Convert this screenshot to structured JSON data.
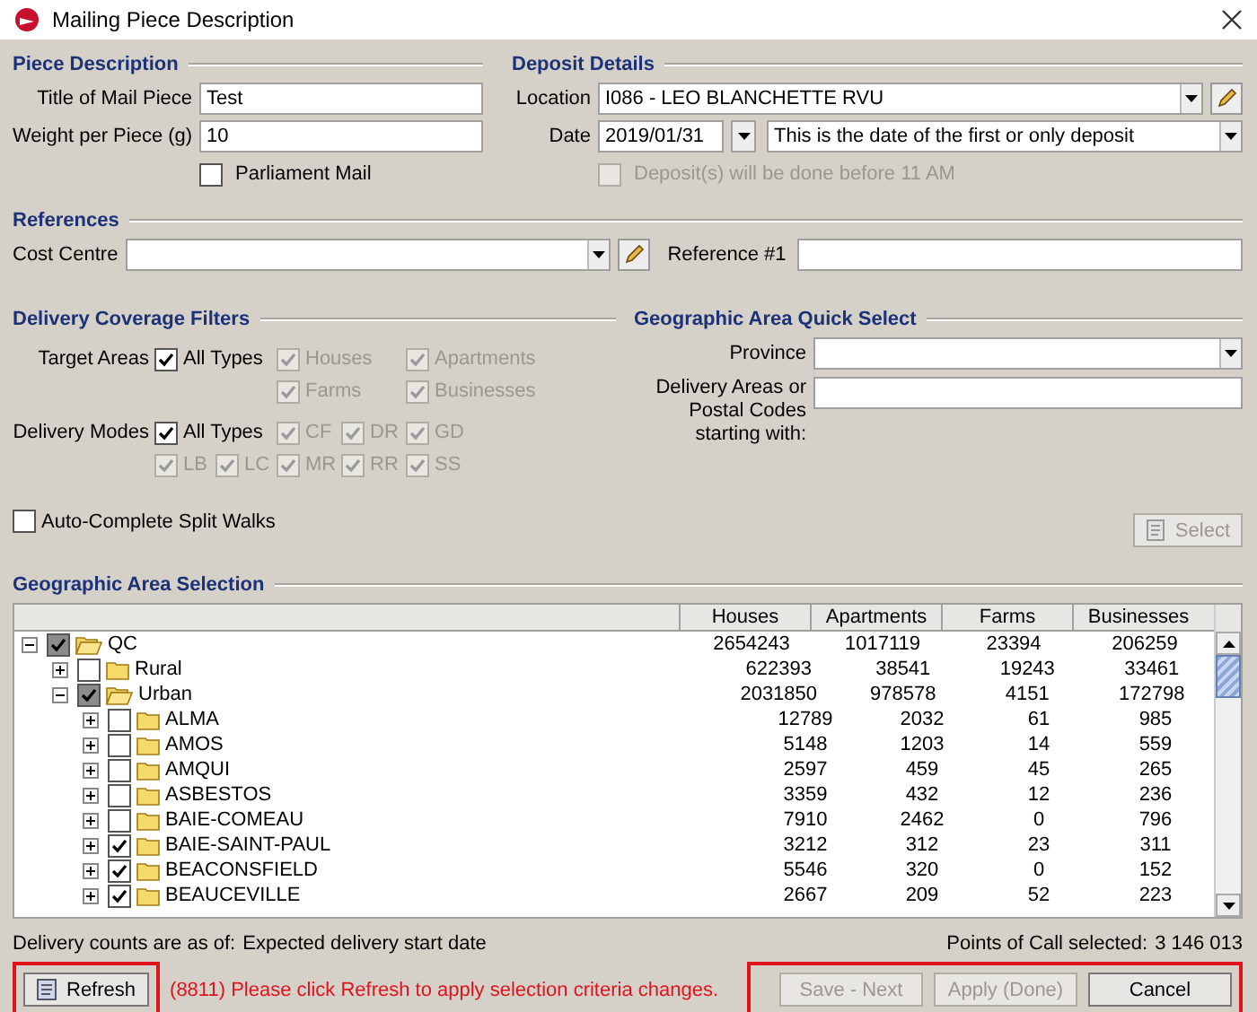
{
  "window": {
    "title": "Mailing Piece Description"
  },
  "piece_description": {
    "heading": "Piece Description",
    "fields": [
      {
        "label": "Title of Mail Piece",
        "value": "Test"
      },
      {
        "label": "Weight per Piece (g)",
        "value": "10"
      }
    ],
    "parliament_mail": {
      "label": "Parliament Mail",
      "checked": false
    }
  },
  "deposit_details": {
    "heading": "Deposit Details",
    "location": {
      "label": "Location",
      "value": "I086 - LEO BLANCHETTE RVU"
    },
    "date": {
      "label": "Date",
      "value": "2019/01/31",
      "note": "This is the date of the first or only deposit"
    },
    "before_11": {
      "label": "Deposit(s) will be done before 11 AM",
      "checked": false,
      "disabled": true
    }
  },
  "references": {
    "heading": "References",
    "cost_centre": {
      "label": "Cost Centre"
    },
    "reference_1": {
      "label": "Reference #1"
    }
  },
  "coverage_filters": {
    "heading": "Delivery Coverage Filters",
    "groups": [
      {
        "label": "Target Areas",
        "all": {
          "label": "All Types",
          "checked": true
        },
        "rows": [
          [
            "",
            "",
            {
              "label": "Houses",
              "checked": true,
              "disabled": true
            },
            "",
            {
              "label": "Apartments",
              "checked": true,
              "disabled": true
            }
          ],
          [
            "",
            "",
            {
              "label": "Farms",
              "checked": true,
              "disabled": true
            },
            "",
            {
              "label": "Businesses",
              "checked": true,
              "disabled": true
            }
          ]
        ]
      },
      {
        "label": "Delivery Modes",
        "all": {
          "label": "All Types",
          "checked": true
        },
        "rows": [
          [
            "",
            "",
            {
              "label": "CF",
              "checked": true,
              "disabled": true
            },
            {
              "label": "DR",
              "checked": true,
              "disabled": true
            },
            {
              "label": "GD",
              "checked": true,
              "disabled": true
            }
          ],
          [
            {
              "label": "LB",
              "checked": true,
              "disabled": true
            },
            {
              "label": "LC",
              "checked": true,
              "disabled": true
            },
            {
              "label": "MR",
              "checked": true,
              "disabled": true
            },
            {
              "label": "RR",
              "checked": true,
              "disabled": true
            },
            {
              "label": "SS",
              "checked": true,
              "disabled": true
            }
          ]
        ]
      }
    ],
    "auto_complete": {
      "label": "Auto-Complete Split Walks",
      "checked": false
    }
  },
  "quick_select": {
    "heading": "Geographic Area Quick Select",
    "province": {
      "label": "Province"
    },
    "areas": {
      "label": "Delivery Areas or Postal Codes starting with:"
    },
    "select_button": {
      "label": "Select",
      "disabled": true
    }
  },
  "geo_selection": {
    "heading": "Geographic Area Selection",
    "columns": [
      "Houses",
      "Apartments",
      "Farms",
      "Businesses"
    ],
    "rows": [
      {
        "name": "QC",
        "expanded": true,
        "checked": true,
        "partial": true,
        "counts": [
          "2654243",
          "1017119",
          "23394",
          "206259"
        ],
        "children": [
          {
            "name": "Rural",
            "expanded": false,
            "checked": false,
            "partial": false,
            "counts": [
              "622393",
              "38541",
              "19243",
              "33461"
            ]
          },
          {
            "name": "Urban",
            "expanded": true,
            "checked": true,
            "partial": true,
            "counts": [
              "2031850",
              "978578",
              "4151",
              "172798"
            ],
            "children": [
              {
                "name": "ALMA",
                "expanded": false,
                "checked": false,
                "partial": false,
                "counts": [
                  "12789",
                  "2032",
                  "61",
                  "985"
                ]
              },
              {
                "name": "AMOS",
                "expanded": false,
                "checked": false,
                "partial": false,
                "counts": [
                  "5148",
                  "1203",
                  "14",
                  "559"
                ]
              },
              {
                "name": "AMQUI",
                "expanded": false,
                "checked": false,
                "partial": false,
                "counts": [
                  "2597",
                  "459",
                  "45",
                  "265"
                ]
              },
              {
                "name": "ASBESTOS",
                "expanded": false,
                "checked": false,
                "partial": false,
                "counts": [
                  "3359",
                  "432",
                  "12",
                  "236"
                ]
              },
              {
                "name": "BAIE-COMEAU",
                "expanded": false,
                "checked": false,
                "partial": false,
                "counts": [
                  "7910",
                  "2462",
                  "0",
                  "796"
                ]
              },
              {
                "name": "BAIE-SAINT-PAUL",
                "expanded": false,
                "checked": true,
                "partial": false,
                "counts": [
                  "3212",
                  "312",
                  "23",
                  "311"
                ]
              },
              {
                "name": "BEACONSFIELD",
                "expanded": false,
                "checked": true,
                "partial": false,
                "counts": [
                  "5546",
                  "320",
                  "0",
                  "152"
                ]
              },
              {
                "name": "BEAUCEVILLE",
                "expanded": false,
                "checked": true,
                "partial": false,
                "counts": [
                  "2667",
                  "209",
                  "52",
                  "223"
                ]
              }
            ]
          }
        ]
      }
    ]
  },
  "footer": {
    "counts_label": "Delivery counts are as of:",
    "counts_value": "Expected delivery start date",
    "points_label": "Points of Call selected:",
    "points_value": "3 146 013",
    "refresh": {
      "label": "Refresh",
      "highlighted": true
    },
    "message": "(8811) Please click Refresh to apply selection criteria changes.",
    "buttons_highlighted": true,
    "buttons": [
      {
        "label": "Save - Next",
        "disabled": true
      },
      {
        "label": "Apply (Done)",
        "disabled": true
      },
      {
        "label": "Cancel",
        "disabled": false
      }
    ]
  }
}
